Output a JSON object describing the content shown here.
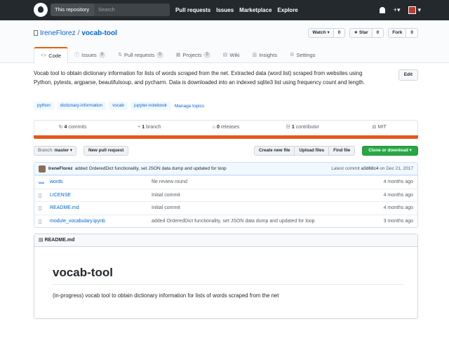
{
  "header": {
    "search_scope": "This repository",
    "search_placeholder": "Search",
    "nav": [
      "Pull requests",
      "Issues",
      "Marketplace",
      "Explore"
    ],
    "plus": "+",
    "caret": "▾"
  },
  "repo": {
    "owner": "IreneFlorez",
    "separator": "/",
    "name": "vocab-tool",
    "actions": [
      {
        "label": "Watch ▾",
        "count": "0",
        "icon": "eye-icon"
      },
      {
        "label": "★ Star",
        "count": "0",
        "icon": "star-icon"
      },
      {
        "label": "Fork",
        "count": "0",
        "icon": "fork-icon"
      }
    ],
    "tabs": [
      {
        "label": "Code",
        "icon": "<>",
        "counter": ""
      },
      {
        "label": "Issues",
        "icon": "ⓘ",
        "counter": "0"
      },
      {
        "label": "Pull requests",
        "icon": "⇅",
        "counter": "0"
      },
      {
        "label": "Projects",
        "icon": "▦",
        "counter": "0"
      },
      {
        "label": "Wiki",
        "icon": "▤",
        "counter": ""
      },
      {
        "label": "Insights",
        "icon": "▥",
        "counter": ""
      },
      {
        "label": "Settings",
        "icon": "⚙",
        "counter": ""
      }
    ]
  },
  "description": "Vocab tool to obtain dictionary information for lists of words scraped from the net. Extracted data (word list) scraped from websites using Python, pytests, argparse, beautifulsoup, and pycharm. Data is downloaded into an indexed sqlite3 list using frequency count and length.",
  "edit_label": "Edit",
  "topics": [
    "python",
    "dictionary-information",
    "vocab",
    "jupyter-notebook"
  ],
  "manage_topics": "Manage topics",
  "summary": [
    {
      "icon": "↻",
      "count": "4",
      "label": "commits"
    },
    {
      "icon": "⑂",
      "count": "1",
      "label": "branch"
    },
    {
      "icon": "⌂",
      "count": "0",
      "label": "releases"
    },
    {
      "icon": "☷",
      "count": "1",
      "label": "contributor"
    },
    {
      "icon": "⚖",
      "count": "",
      "label": "MIT"
    }
  ],
  "language_color": "#e2591c",
  "branch": {
    "label": "Branch:",
    "value": "master ▾"
  },
  "new_pr": "New pull request",
  "file_buttons": [
    "Create new file",
    "Upload files",
    "Find file"
  ],
  "clone": "Clone or download ▾",
  "latest_commit": {
    "author": "IreneFlorez",
    "message": "added OrderedDict functionality, set JSON data dump and updated for loop",
    "prefix": "Latest commit",
    "sha": "a3d68c4",
    "date": "on Dec 21, 2017"
  },
  "files": [
    {
      "type": "dir",
      "name": "words",
      "message": "file review round",
      "age": "4 months ago"
    },
    {
      "type": "file",
      "name": "LICENSE",
      "message": "Initial commit",
      "age": "4 months ago"
    },
    {
      "type": "file",
      "name": "README.md",
      "message": "Initial commit",
      "age": "4 months ago"
    },
    {
      "type": "file",
      "name": "module_vocabulary.ipynb",
      "message": "added OrderedDict functionality, set JSON data dump and updated for loop",
      "age": "3 months ago"
    }
  ],
  "readme": {
    "filename": "README.md",
    "title": "vocab-tool",
    "body": "(in-progress) vocab tool to obtain dictionary information for lists of words scraped from the net"
  }
}
